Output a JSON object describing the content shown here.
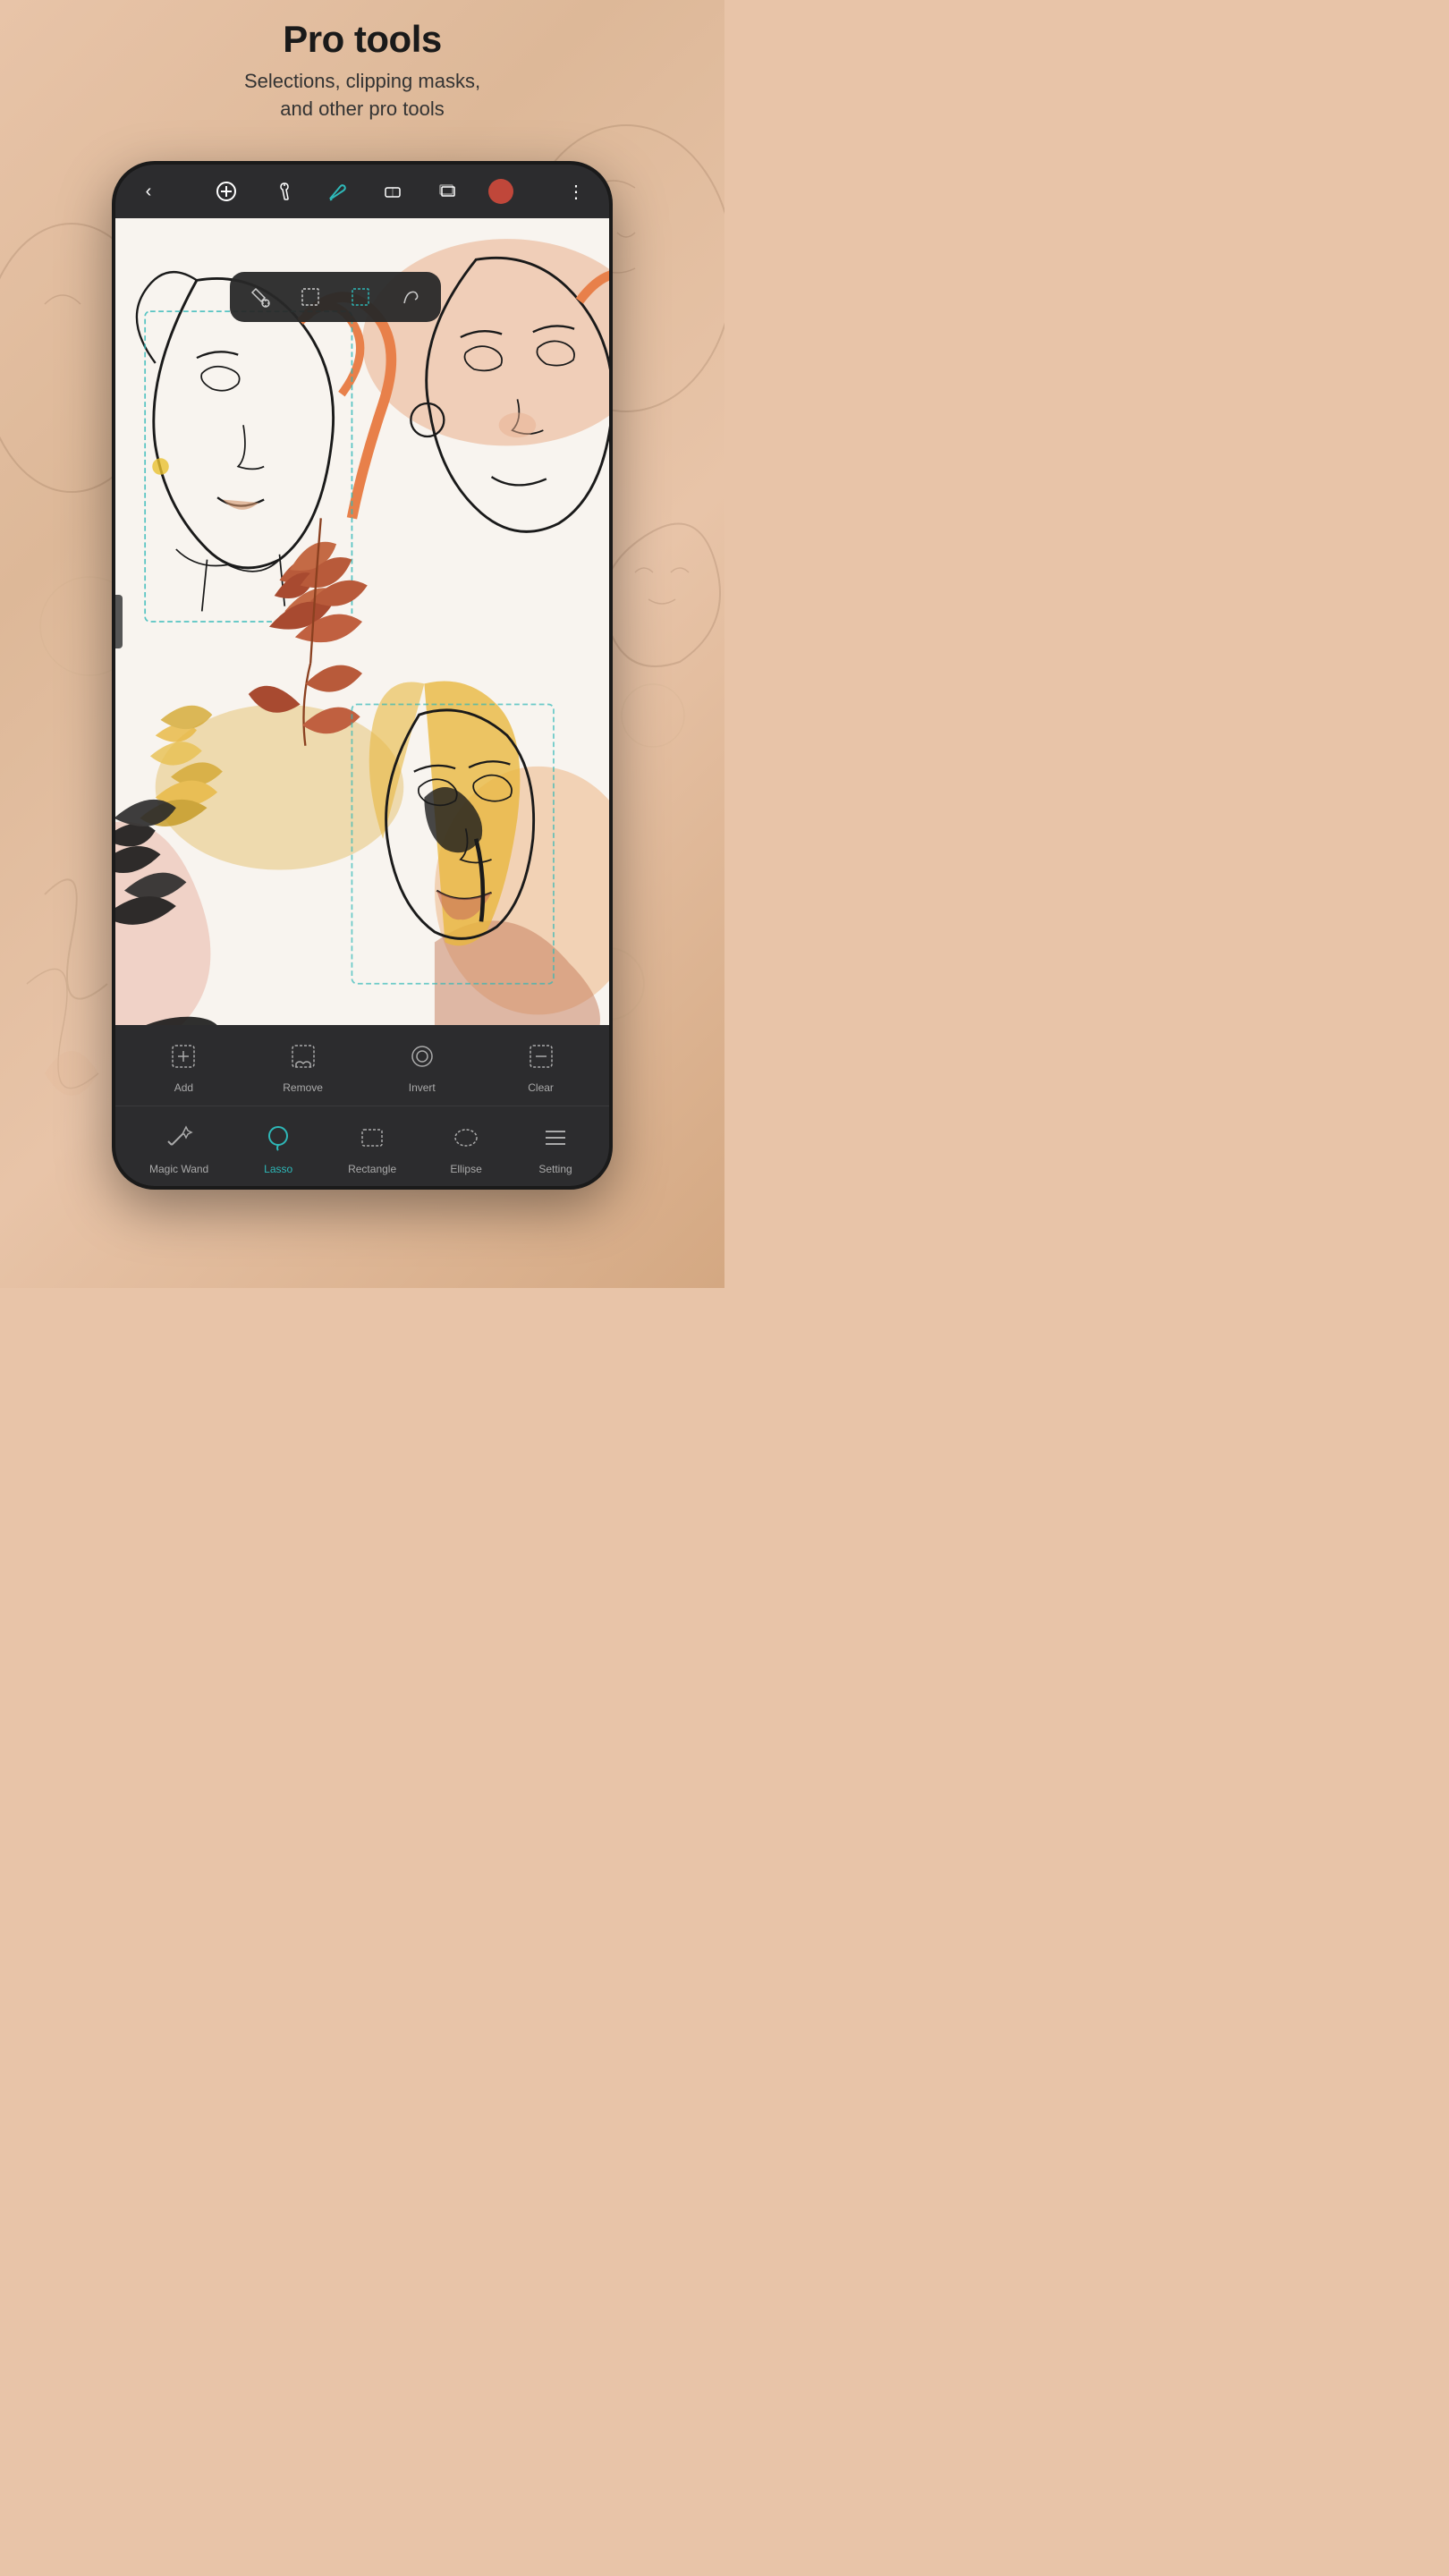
{
  "page": {
    "title": "Pro tools",
    "subtitle": "Selections, clipping masks,\nand other pro tools"
  },
  "toolbar": {
    "back_label": "‹",
    "add_label": "+",
    "wrench_label": "🔧",
    "brush_label": "✏",
    "eraser_label": "◻",
    "layers_label": "⧉",
    "color_hex": "#c0473a",
    "more_label": "⋮"
  },
  "selection_popup": {
    "tools": [
      {
        "name": "flood-fill",
        "icon": "💧",
        "active": false
      },
      {
        "name": "rect-select",
        "icon": "⬜",
        "active": false
      },
      {
        "name": "lasso-select",
        "icon": "⬜",
        "active": true
      },
      {
        "name": "freehand",
        "icon": "✏",
        "active": false
      }
    ]
  },
  "action_bar": {
    "items": [
      {
        "id": "add",
        "label": "Add",
        "icon": "⬜"
      },
      {
        "id": "remove",
        "label": "Remove",
        "icon": "📋"
      },
      {
        "id": "invert",
        "label": "Invert",
        "icon": "⊙"
      },
      {
        "id": "clear",
        "label": "Clear",
        "icon": "⬜"
      }
    ]
  },
  "tool_bar": {
    "items": [
      {
        "id": "magic-wand",
        "label": "Magic Wand",
        "active": false
      },
      {
        "id": "lasso",
        "label": "Lasso",
        "active": true
      },
      {
        "id": "rectangle",
        "label": "Rectangle",
        "active": false
      },
      {
        "id": "ellipse",
        "label": "Ellipse",
        "active": false
      },
      {
        "id": "setting",
        "label": "Setting",
        "active": false
      }
    ]
  },
  "colors": {
    "accent": "#2eb8b8",
    "toolbar_bg": "#2c2c2e",
    "canvas_bg": "#f5f0ea"
  }
}
